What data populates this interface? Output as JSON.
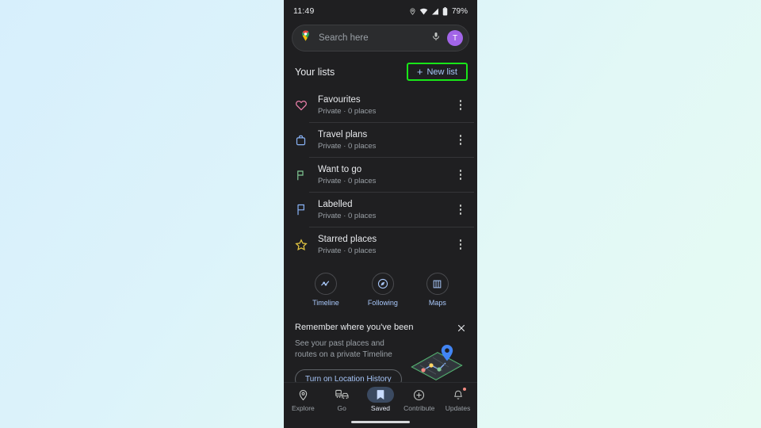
{
  "colors": {
    "page_bg_start": "#d7effc",
    "page_bg_end": "#e6fbf3",
    "phone_bg": "#1f1f21",
    "accent_blue": "#a8c7fa",
    "highlight_green": "#19e619",
    "text_primary": "#e8eaed",
    "text_secondary": "#9aa0a6",
    "heart_pink": "#e77ea8",
    "suitcase_blue": "#8ab4f8",
    "flag_green": "#81c995",
    "flag_blue": "#8ab4f8",
    "star_yellow": "#e0c341",
    "badge_red": "#f28b82",
    "avatar_purple": "#a265e8"
  },
  "statusbar": {
    "time": "11:49",
    "battery_percent": "79%",
    "icons": [
      "location-pin-icon",
      "wifi-icon",
      "signal-icon",
      "battery-icon"
    ]
  },
  "search": {
    "placeholder": "Search here",
    "logo_icon": "google-maps-pin-icon",
    "mic_icon": "microphone-icon",
    "avatar_initial": "T"
  },
  "lists_header": {
    "title": "Your lists",
    "new_list_label": "New list",
    "new_list_plus": "+",
    "highlighted": true
  },
  "lists": [
    {
      "name": "Favourites",
      "subtitle": "Private · 0 places",
      "icon": "heart-icon",
      "color": "#e77ea8"
    },
    {
      "name": "Travel plans",
      "subtitle": "Private · 0 places",
      "icon": "suitcase-icon",
      "color": "#8ab4f8"
    },
    {
      "name": "Want to go",
      "subtitle": "Private · 0 places",
      "icon": "flag-filled-icon",
      "color": "#81c995"
    },
    {
      "name": "Labelled",
      "subtitle": "Private · 0 places",
      "icon": "flag-outline-icon",
      "color": "#8ab4f8"
    },
    {
      "name": "Starred places",
      "subtitle": "Private · 0 places",
      "icon": "star-icon",
      "color": "#e0c341"
    }
  ],
  "actions": [
    {
      "label": "Timeline",
      "icon": "timeline-chart-icon"
    },
    {
      "label": "Following",
      "icon": "compass-icon"
    },
    {
      "label": "Maps",
      "icon": "map-book-icon"
    }
  ],
  "promo": {
    "title": "Remember where you've been",
    "description": "See your past places and routes on a private Timeline",
    "button_label": "Turn on Location History",
    "close_icon": "close-icon",
    "illustration": "isometric-map-route-icon"
  },
  "bottom_nav": [
    {
      "label": "Explore",
      "icon": "location-pin-icon",
      "active": false,
      "badge": false
    },
    {
      "label": "Go",
      "icon": "commute-icon",
      "active": false,
      "badge": false
    },
    {
      "label": "Saved",
      "icon": "bookmark-icon",
      "active": true,
      "badge": false
    },
    {
      "label": "Contribute",
      "icon": "plus-circle-icon",
      "active": false,
      "badge": false
    },
    {
      "label": "Updates",
      "icon": "bell-icon",
      "active": false,
      "badge": true
    }
  ]
}
